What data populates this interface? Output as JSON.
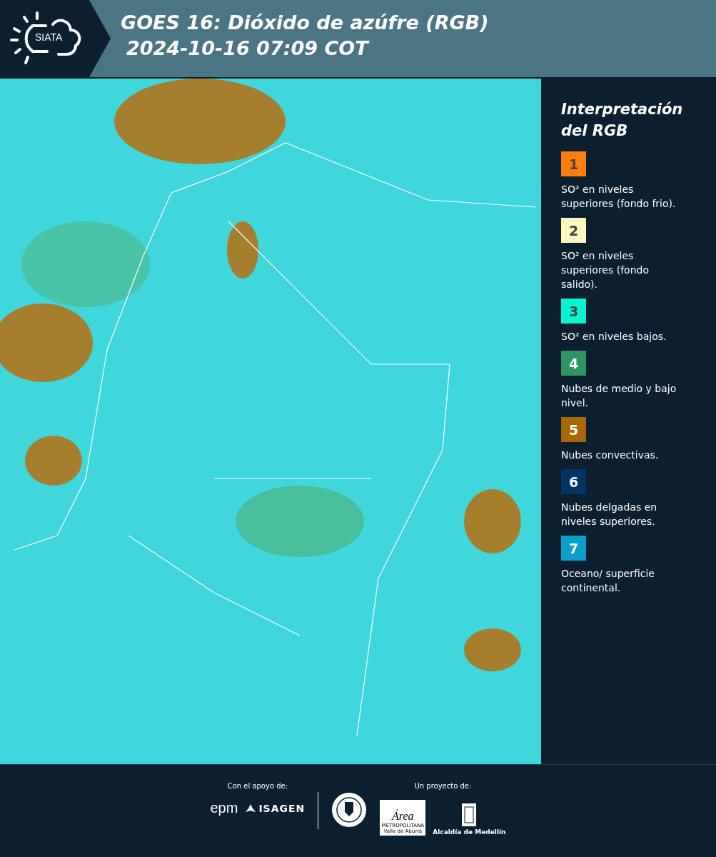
{
  "header": {
    "logo": "SIATA",
    "title": "GOES 16: Dióxido de azúfre (RGB)",
    "timestamp": "2024-10-16 07:09 COT"
  },
  "legend": {
    "title": "Interpretación del RGB",
    "items": [
      {
        "number": "1",
        "color": "#ff7f0e",
        "text": "SO² en niveles superiores (fondo frio)."
      },
      {
        "number": "2",
        "color": "#fff9c0",
        "text": "SO² en niveles superiores (fondo salido)."
      },
      {
        "number": "3",
        "color": "#00f5d0",
        "text": "SO² en niveles bajos."
      },
      {
        "number": "4",
        "color": "#2e9466",
        "text": "Nubes de medio y bajo nivel."
      },
      {
        "number": "5",
        "color": "#a86a00",
        "text": "Nubes convectivas."
      },
      {
        "number": "6",
        "color": "#003366",
        "text": "Nubes delgadas en niveles superiores."
      },
      {
        "number": "7",
        "color": "#0a9fcb",
        "text": "Oceano/ superficie continental."
      }
    ]
  },
  "footer": {
    "support_label": "Con el apoyo de:",
    "support_logos": [
      "epm",
      "ISAGEN"
    ],
    "project_label": "Un proyecto de:",
    "area_logo": {
      "name": "Área",
      "line1": "METROPOLITANA",
      "line2": "Valle de Aburrá"
    },
    "city_logo": "Alcaldía de Medellín"
  }
}
